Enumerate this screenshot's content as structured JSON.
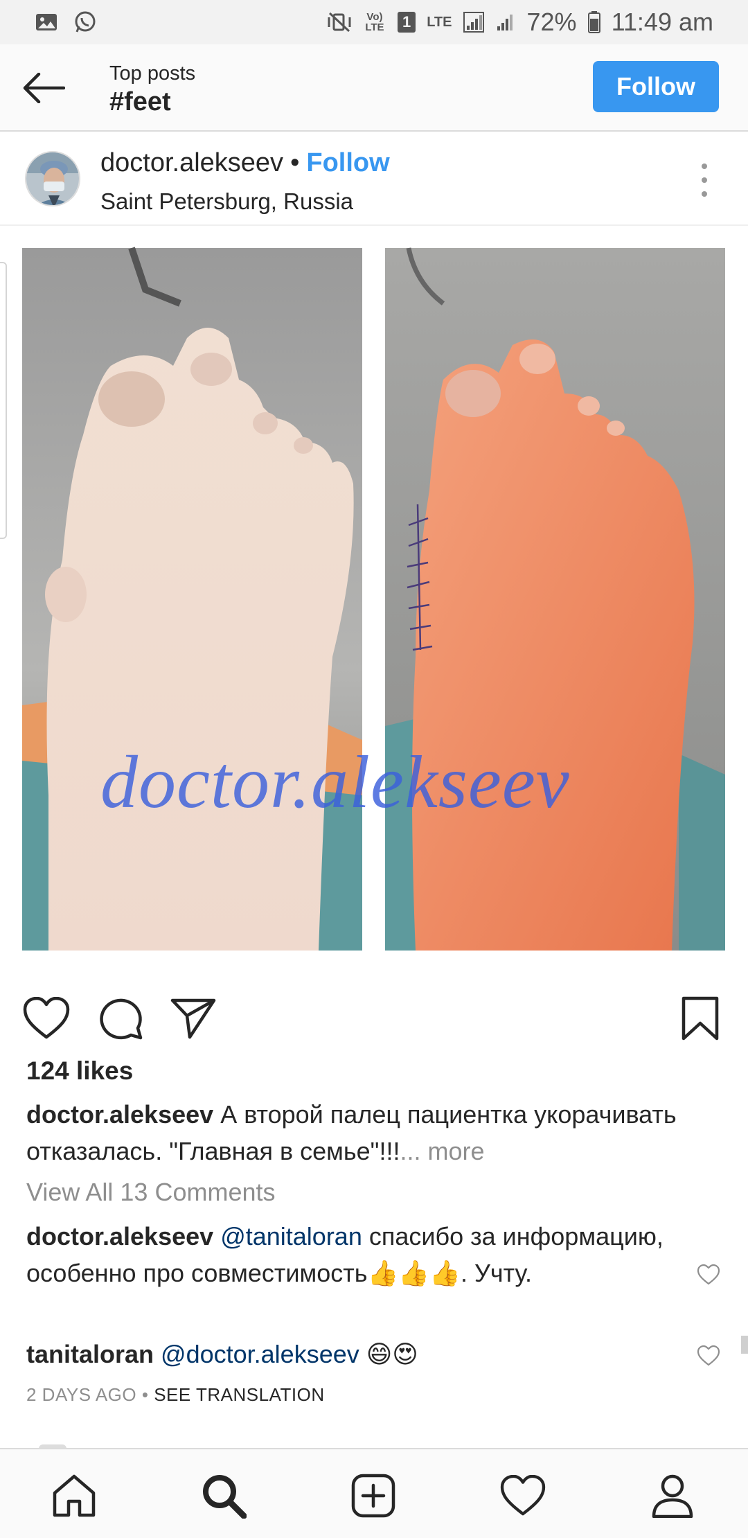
{
  "status_bar": {
    "lte_label": "LTE",
    "volte_label": "Vo) LTE",
    "sim_label": "1",
    "battery": "72%",
    "time": "11:49 am"
  },
  "header": {
    "subtitle": "Top posts",
    "title": "#feet",
    "follow_label": "Follow"
  },
  "post": {
    "username": "doctor.alekseev",
    "separator": "•",
    "follow_label": "Follow",
    "location": "Saint Petersburg, Russia",
    "watermark": "doctor.alekseev",
    "likes": "124 likes",
    "caption_user": "doctor.alekseev",
    "caption_text": "А второй палец пациентка укорачивать отказалась. \"Главная в семье\"!!!",
    "caption_more": "... more",
    "view_all": "View All 13 Comments"
  },
  "comments": [
    {
      "user": "doctor.alekseev",
      "mention": "@tanitaloran",
      "text": "спасибо за информацию, особенно про совместимость",
      "emoji": "👍👍👍",
      "suffix": ". Учту."
    },
    {
      "user": "tanitaloran",
      "mention": "@doctor.alekseev",
      "text": "",
      "emoji": "😄😍",
      "suffix": ""
    }
  ],
  "meta": {
    "time_ago": "2 DAYS AGO",
    "dot": "•",
    "see_translation": "SEE TRANSLATION"
  },
  "icons": {
    "back": "arrow-left-icon",
    "like": "heart-icon",
    "comment": "comment-bubble-icon",
    "share": "paper-plane-icon",
    "save": "bookmark-icon",
    "home": "home-icon",
    "search": "search-icon",
    "new_post": "plus-square-icon",
    "activity": "heart-outline-icon",
    "profile": "user-icon"
  },
  "colors": {
    "accent": "#3897f0",
    "text": "#262626",
    "muted": "#8e8e8e",
    "mention": "#003569",
    "watermark": "#3a5fdc"
  }
}
